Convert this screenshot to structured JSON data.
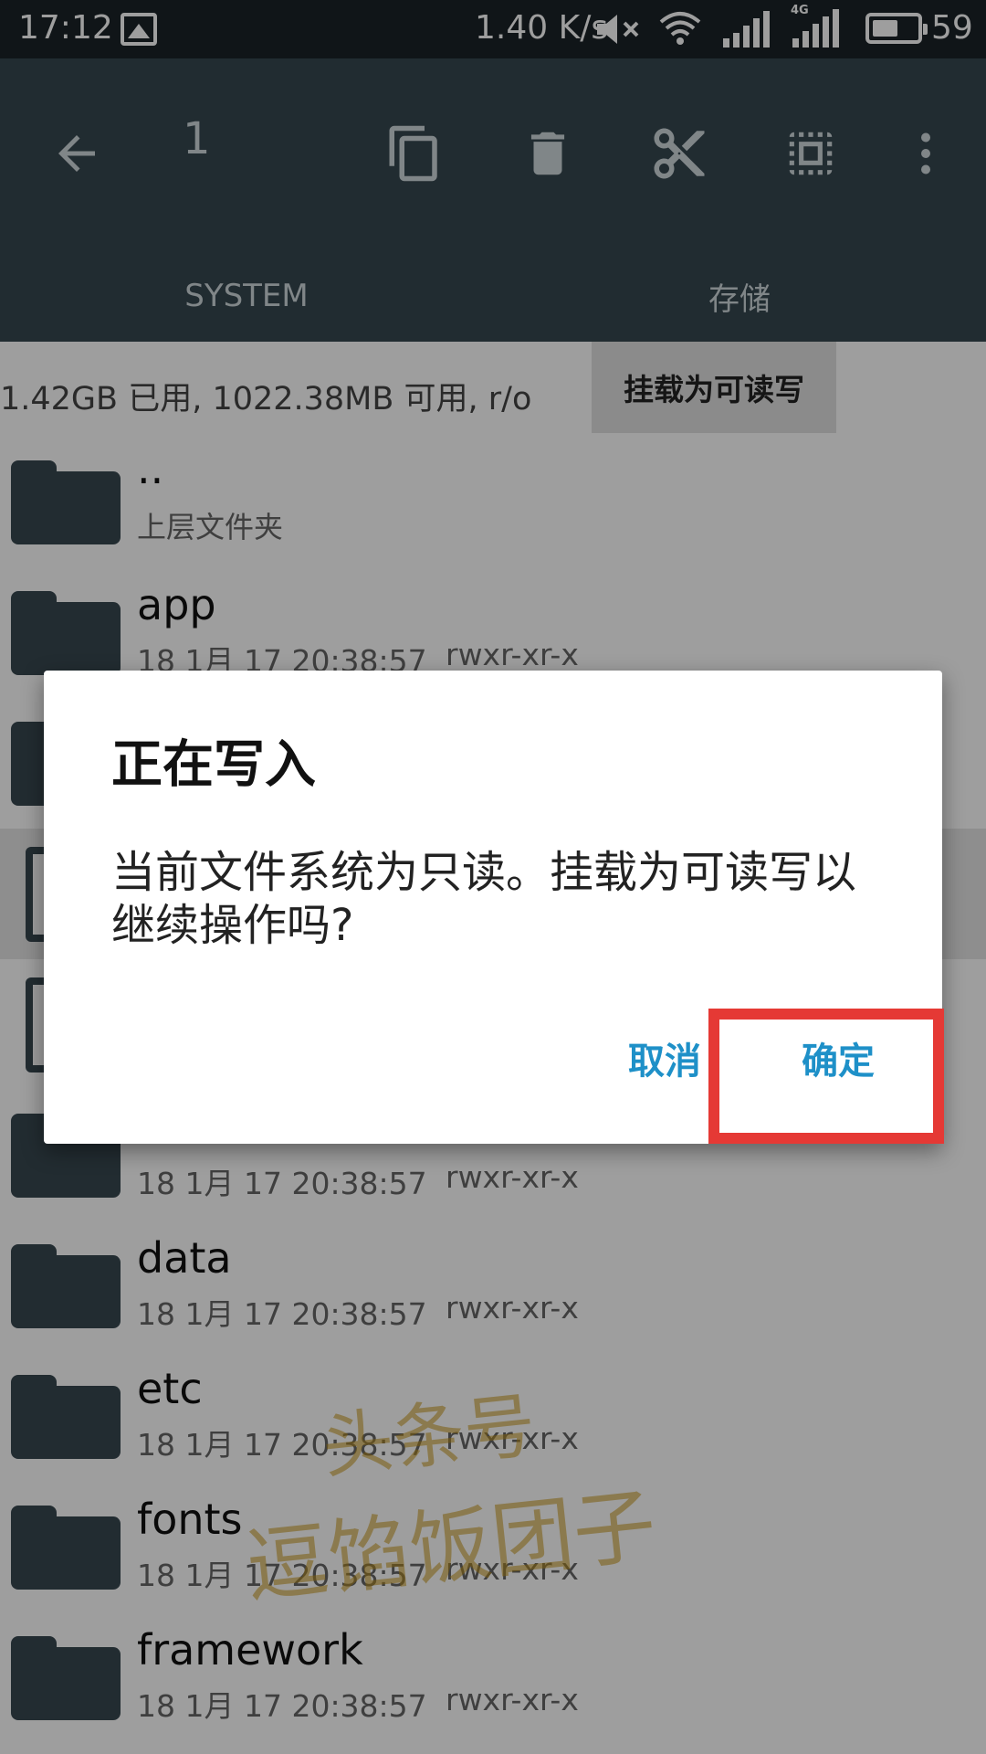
{
  "status_bar": {
    "time": "17:12",
    "net_speed": "1.40 K/s",
    "network_type": "4G",
    "battery": "59",
    "battery_level_percent": 59
  },
  "toolbar": {
    "selected_count": "1",
    "icons": [
      "back-arrow-icon",
      "copy-icon",
      "delete-icon",
      "cut-icon",
      "select-all-icon",
      "more-vert-icon"
    ]
  },
  "tabs": [
    {
      "label": "SYSTEM",
      "active": true
    },
    {
      "label": "存储",
      "active": false
    }
  ],
  "storage": {
    "info": "1.42GB 已用, 1022.38MB 可用, r/o",
    "mount_button": "挂载为可读写"
  },
  "files": [
    {
      "name": "..",
      "sub": "上层文件夹",
      "perm": ""
    },
    {
      "name": "app",
      "sub": "18 1月 17 20:38:57",
      "perm": "rwxr-xr-x"
    },
    {
      "name": "",
      "sub": "",
      "perm": ""
    },
    {
      "name": "",
      "sub": "",
      "perm": ""
    },
    {
      "name": "",
      "sub": "",
      "perm": ""
    },
    {
      "name": "",
      "sub": "18 1月 17 20:38:57",
      "perm": "rwxr-xr-x"
    },
    {
      "name": "data",
      "sub": "18 1月 17 20:38:57",
      "perm": "rwxr-xr-x"
    },
    {
      "name": "etc",
      "sub": "18 1月 17 20:38:57",
      "perm": "rwxr-xr-x"
    },
    {
      "name": "fonts",
      "sub": "18 1月 17 20:38:57",
      "perm": "rwxr-xr-x"
    },
    {
      "name": "framework",
      "sub": "18 1月 17 20:38:57",
      "perm": "rwxr-xr-x"
    }
  ],
  "watermark": {
    "line1": "头条号",
    "line2": "逗馅饭团子"
  },
  "dialog": {
    "title": "正在写入",
    "message": "当前文件系统为只读。挂载为可读写以继续操作吗?",
    "cancel_label": "取消",
    "ok_label": "确定"
  },
  "colors": {
    "toolbar": "#36474f",
    "status_bar": "#1b2327",
    "accent": "#1e90c8",
    "folder": "#37474f",
    "highlight": "#e53935"
  }
}
